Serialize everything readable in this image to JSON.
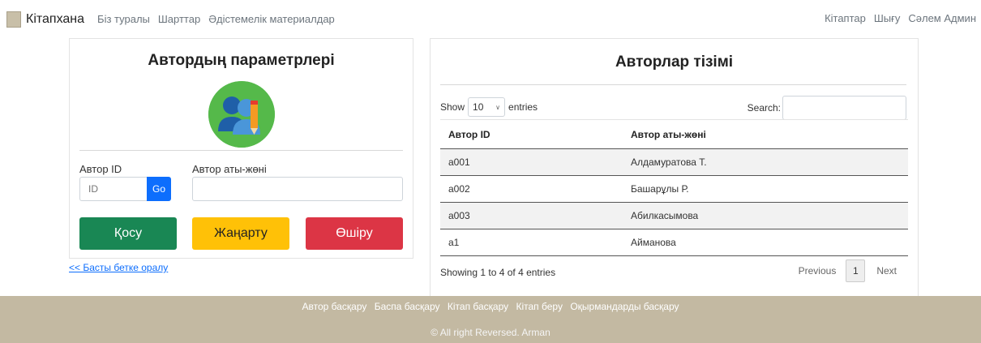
{
  "nav": {
    "brand": "Кітапхана",
    "left_links": [
      "Біз туралы",
      "Шарттар",
      "Әдістемелік материалдар"
    ],
    "right_links": [
      "Кітаптар",
      "Шығу",
      "Сәлем Админ"
    ]
  },
  "left_card": {
    "title": "Автордың параметрлері",
    "id_label": "Автор ID",
    "id_placeholder": "ID",
    "go_label": "Go",
    "name_label": "Автор аты-жөні",
    "add_label": "Қосу",
    "update_label": "Жаңарту",
    "delete_label": "Өшіру",
    "back_link": "<< Басты бетке оралу"
  },
  "right_card": {
    "title": "Авторлар тізімі",
    "show_label": "Show",
    "entries_value": "10",
    "entries_label": "entries",
    "search_label": "Search:",
    "columns": [
      "Автор ID",
      "Автор аты-жөні"
    ],
    "rows": [
      [
        "a001",
        "Алдамуратова Т."
      ],
      [
        "a002",
        "Башарұлы Р."
      ],
      [
        "a003",
        "Абилкасымова"
      ],
      [
        "a1",
        "Айманова"
      ]
    ],
    "info": "Showing 1 to 4 of 4 entries",
    "prev": "Previous",
    "page": "1",
    "next": "Next"
  },
  "footer": {
    "links": [
      "Автор басқару",
      "Баспа басқару",
      "Кітап басқару",
      "Кітап беру",
      "Оқырмандарды басқару"
    ],
    "copyright": "© All right Reversed. Arman"
  },
  "colors": {
    "footer": "#c3b9a2",
    "add": "#198754",
    "update": "#ffc107",
    "delete": "#dc3545",
    "primary": "#0d6efd"
  }
}
